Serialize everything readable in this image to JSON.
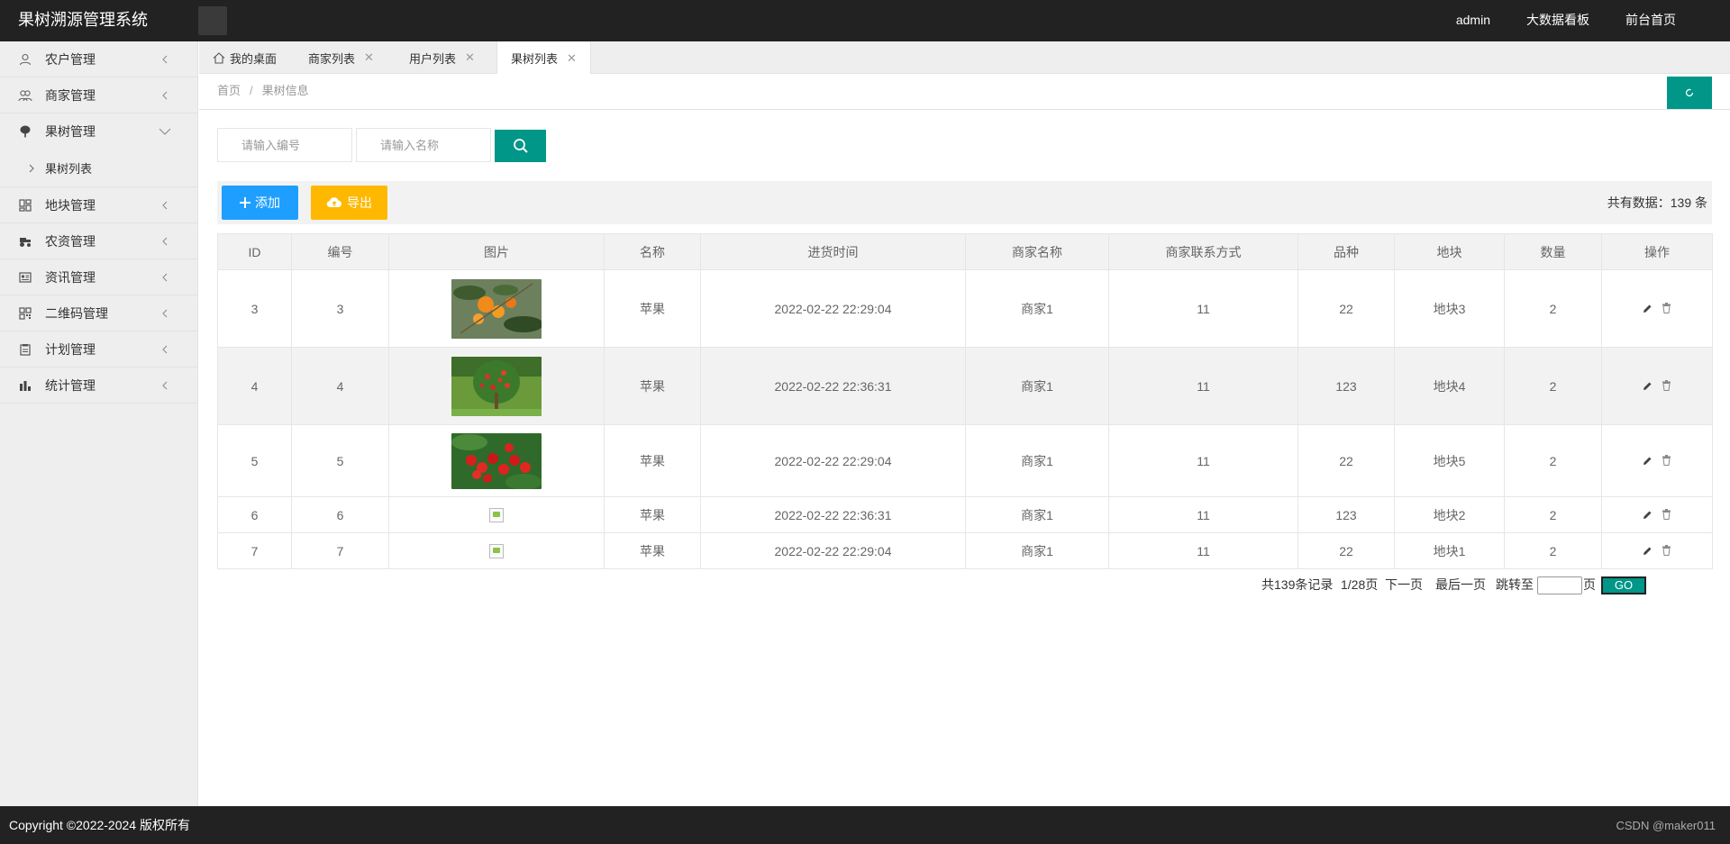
{
  "header": {
    "title": "果树溯源管理系统",
    "nav": [
      "admin",
      "大数据看板",
      "前台首页"
    ]
  },
  "sidebar": {
    "items": [
      {
        "label": "农户管理",
        "icon": "user-icon"
      },
      {
        "label": "商家管理",
        "icon": "users-icon"
      },
      {
        "label": "果树管理",
        "icon": "tree-icon",
        "expanded": true,
        "children": [
          {
            "label": "果树列表"
          }
        ]
      },
      {
        "label": "地块管理",
        "icon": "grid-icon"
      },
      {
        "label": "农资管理",
        "icon": "tractor-icon"
      },
      {
        "label": "资讯管理",
        "icon": "news-icon"
      },
      {
        "label": "二维码管理",
        "icon": "qrcode-icon"
      },
      {
        "label": "计划管理",
        "icon": "plan-icon"
      },
      {
        "label": "统计管理",
        "icon": "chart-icon"
      }
    ]
  },
  "tabs": [
    {
      "label": "我的桌面",
      "home": true
    },
    {
      "label": "商家列表"
    },
    {
      "label": "用户列表"
    },
    {
      "label": "果树列表",
      "active": true
    }
  ],
  "breadcrumb": [
    "首页",
    "果树信息"
  ],
  "search": {
    "code_placeholder": "请输入编号",
    "name_placeholder": "请输入名称"
  },
  "toolbar": {
    "add_label": "添加",
    "export_label": "导出",
    "total_label": "共有数据：139 条"
  },
  "table": {
    "columns": [
      "ID",
      "编号",
      "图片",
      "名称",
      "进货时间",
      "商家名称",
      "商家联系方式",
      "品种",
      "地块",
      "数量",
      "操作"
    ],
    "rows": [
      {
        "id": "3",
        "code": "3",
        "image": "orange",
        "name": "苹果",
        "time": "2022-02-22 22:29:04",
        "merchant": "商家1",
        "contact": "11",
        "variety": "22",
        "plot": "地块3",
        "qty": "2"
      },
      {
        "id": "4",
        "code": "4",
        "image": "appletree",
        "name": "苹果",
        "time": "2022-02-22 22:36:31",
        "merchant": "商家1",
        "contact": "11",
        "variety": "123",
        "plot": "地块4",
        "qty": "2"
      },
      {
        "id": "5",
        "code": "5",
        "image": "cherry",
        "name": "苹果",
        "time": "2022-02-22 22:29:04",
        "merchant": "商家1",
        "contact": "11",
        "variety": "22",
        "plot": "地块5",
        "qty": "2"
      },
      {
        "id": "6",
        "code": "6",
        "image": "broken",
        "name": "苹果",
        "time": "2022-02-22 22:36:31",
        "merchant": "商家1",
        "contact": "11",
        "variety": "123",
        "plot": "地块2",
        "qty": "2"
      },
      {
        "id": "7",
        "code": "7",
        "image": "broken",
        "name": "苹果",
        "time": "2022-02-22 22:29:04",
        "merchant": "商家1",
        "contact": "11",
        "variety": "22",
        "plot": "地块1",
        "qty": "2"
      }
    ]
  },
  "pagination": {
    "total": "共139条记录",
    "page": "1/28页",
    "next": "下一页",
    "last": "最后一页",
    "jump": "跳转至",
    "page_unit": "页",
    "go": "GO"
  },
  "footer": {
    "copyright": "Copyright ©2022-2024 版权所有",
    "watermark": "CSDN @maker011"
  },
  "colors": {
    "header_bg": "#222222",
    "accent": "#009688",
    "add_btn": "#1E9FFF",
    "export_btn": "#FFB800"
  }
}
